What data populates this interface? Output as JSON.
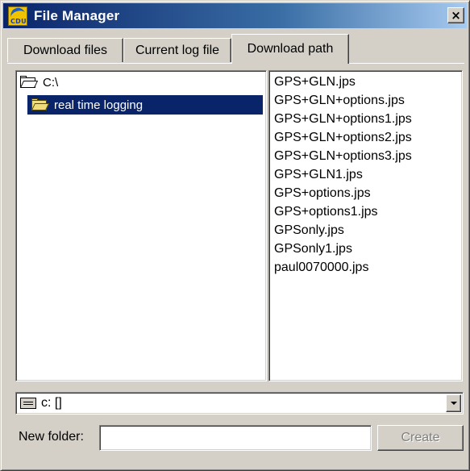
{
  "window": {
    "title": "File Manager",
    "icon": "cdu-app-icon",
    "icon_text": "CDU",
    "close_glyph": "×"
  },
  "tabs": [
    {
      "label": "Download files",
      "active": false
    },
    {
      "label": "Current log file",
      "active": false
    },
    {
      "label": "Download path",
      "active": true
    }
  ],
  "tree": {
    "items": [
      {
        "label": "C:\\",
        "icon": "open-folder-icon",
        "selected": false
      },
      {
        "label": "real time logging",
        "icon": "open-folder-icon",
        "selected": true
      }
    ]
  },
  "files": [
    "GPS+GLN.jps",
    "GPS+GLN+options.jps",
    "GPS+GLN+options1.jps",
    "GPS+GLN+options2.jps",
    "GPS+GLN+options3.jps",
    "GPS+GLN1.jps",
    "GPS+options.jps",
    "GPS+options1.jps",
    "GPSonly.jps",
    "GPSonly1.jps",
    "paul0070000.jps"
  ],
  "drive": {
    "value": "c: []",
    "icon": "drive-icon"
  },
  "new_folder": {
    "label": "New folder:",
    "value": "",
    "create_label": "Create",
    "create_enabled": false
  },
  "colors": {
    "titlebar_start": "#0a246a",
    "titlebar_end": "#a6caf0",
    "selection": "#0a246a",
    "face": "#d4d0c8"
  }
}
